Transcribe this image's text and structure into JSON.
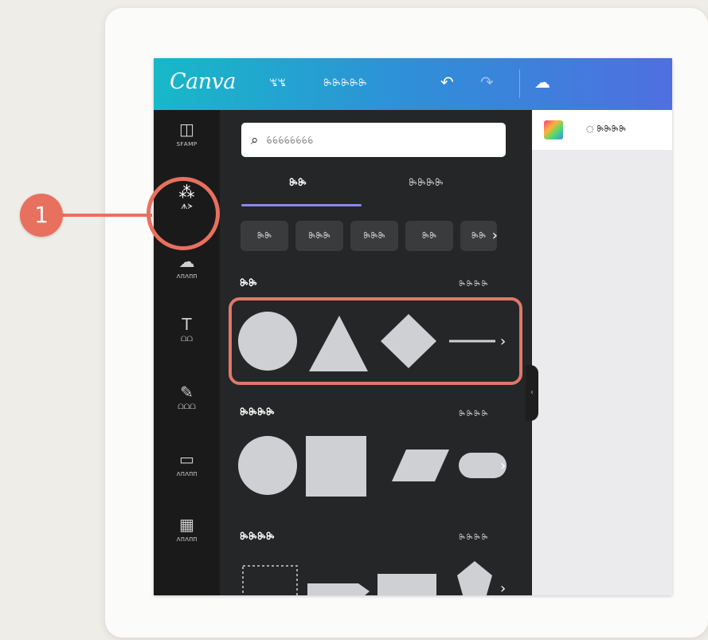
{
  "app": {
    "logo": "Canva"
  },
  "topbar": {
    "menu_items": [
      "ꖚꖚ",
      "ꖞꖞꖞꖞꖞ"
    ],
    "undo_icon": "undo-icon",
    "redo_icon": "redo-icon",
    "cloud_icon": "cloud-icon"
  },
  "sidebar": {
    "items": [
      {
        "label": "ꜱꜰᴀᴍᴘ",
        "icon": "template-icon"
      },
      {
        "label": "ᗑᗒ",
        "icon": "elements-icon"
      },
      {
        "label": "ᴧᴨᴧᴨᴨ",
        "icon": "upload-icon"
      },
      {
        "label": "ᗝᗝ",
        "icon": "text-icon"
      },
      {
        "label": "ᗝᗝᗝ",
        "icon": "draw-icon"
      },
      {
        "label": "ᴧᴨᴧᴨᴨ",
        "icon": "folder-icon"
      },
      {
        "label": "ᴧᴨᴧᴨᴨ",
        "icon": "apps-icon"
      }
    ]
  },
  "search": {
    "placeholder": "ꕃꕃꕃꕃꕃꕃꕃꕃ"
  },
  "tabs": [
    {
      "label": "ꖞꖞ"
    },
    {
      "label": "ꖞꖞꖞꖞ"
    }
  ],
  "chips": [
    "ꖞꖞ",
    "ꖞꖞꖞ",
    "ꖞꖞꖞ",
    "ꖞꖞ",
    "ꖞꖞ"
  ],
  "sections": [
    {
      "title": "ꖞꖞ",
      "more": "ꖞꖞꖞꖞ"
    },
    {
      "title": "ꖞꖞꖞꖞ",
      "more": "ꖞꖞꖞꖞ"
    },
    {
      "title": "ꖞꖞꖞꖞ",
      "more": "ꖞꖞꖞꖞ"
    }
  ],
  "canvas": {
    "animate_label": "ꖞꖞꖞꖞ"
  },
  "callout": {
    "number": "1"
  },
  "colors": {
    "accent": "#e8705e",
    "tab_underline": "#8b86f0",
    "topbar_start": "#18b8c8",
    "topbar_end": "#4f6fe0",
    "shape_fill": "#cfd0d3"
  }
}
